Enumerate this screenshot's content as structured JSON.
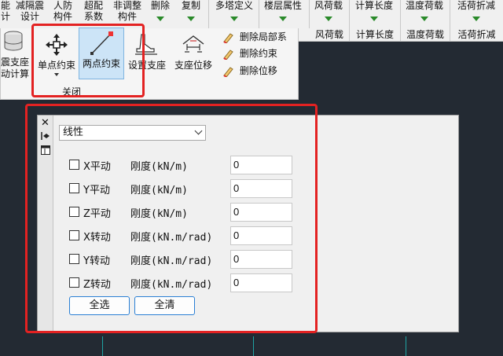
{
  "ribbon_top": [
    {
      "line1": "能",
      "line2": "计"
    },
    {
      "line1": "减隔震",
      "line2": "设计"
    },
    {
      "line1": "人防",
      "line2": "构件"
    },
    {
      "line1": "超配",
      "line2": "系数"
    },
    {
      "line1": "非调整",
      "line2": "构件"
    },
    {
      "line1": "删除",
      "line2": ""
    },
    {
      "line1": "复制",
      "line2": ""
    },
    {
      "line1": "多塔定义",
      "line2": ""
    },
    {
      "line1": "楼层属性",
      "line2": ""
    },
    {
      "line1": "风荷载",
      "line2": ""
    },
    {
      "line1": "计算长度",
      "line2": ""
    },
    {
      "line1": "温度荷载",
      "line2": ""
    },
    {
      "line1": "活荷折减",
      "line2": ""
    }
  ],
  "ribbon_group_labels": [
    "风荷载",
    "计算长度",
    "温度荷载",
    "活荷折减"
  ],
  "left_panel": {
    "line1": "震支座",
    "line2": "动计算"
  },
  "panel": {
    "group_label": "关闭",
    "big_buttons": [
      "单点约束",
      "两点约束",
      "设置支座",
      "支座位移"
    ],
    "small_buttons": [
      "删除局部系",
      "删除约束",
      "删除位移"
    ]
  },
  "dialog": {
    "mode_select": "线性",
    "rows": [
      {
        "label": "X平动",
        "stiffness": "刚度(kN/m)",
        "value": "0"
      },
      {
        "label": "Y平动",
        "stiffness": "刚度(kN/m)",
        "value": "0"
      },
      {
        "label": "Z平动",
        "stiffness": "刚度(kN/m)",
        "value": "0"
      },
      {
        "label": "X转动",
        "stiffness": "刚度(kN.m/rad)",
        "value": "0"
      },
      {
        "label": "Y转动",
        "stiffness": "刚度(kN.m/rad)",
        "value": "0"
      },
      {
        "label": "Z转动",
        "stiffness": "刚度(kN.m/rad)",
        "value": "0"
      }
    ],
    "select_all": "全选",
    "clear_all": "全清"
  },
  "colors": {
    "highlight": "#e32222",
    "accent_green": "#2a8a2a",
    "active_button": "#cce4f7",
    "canvas": "#232a33"
  }
}
